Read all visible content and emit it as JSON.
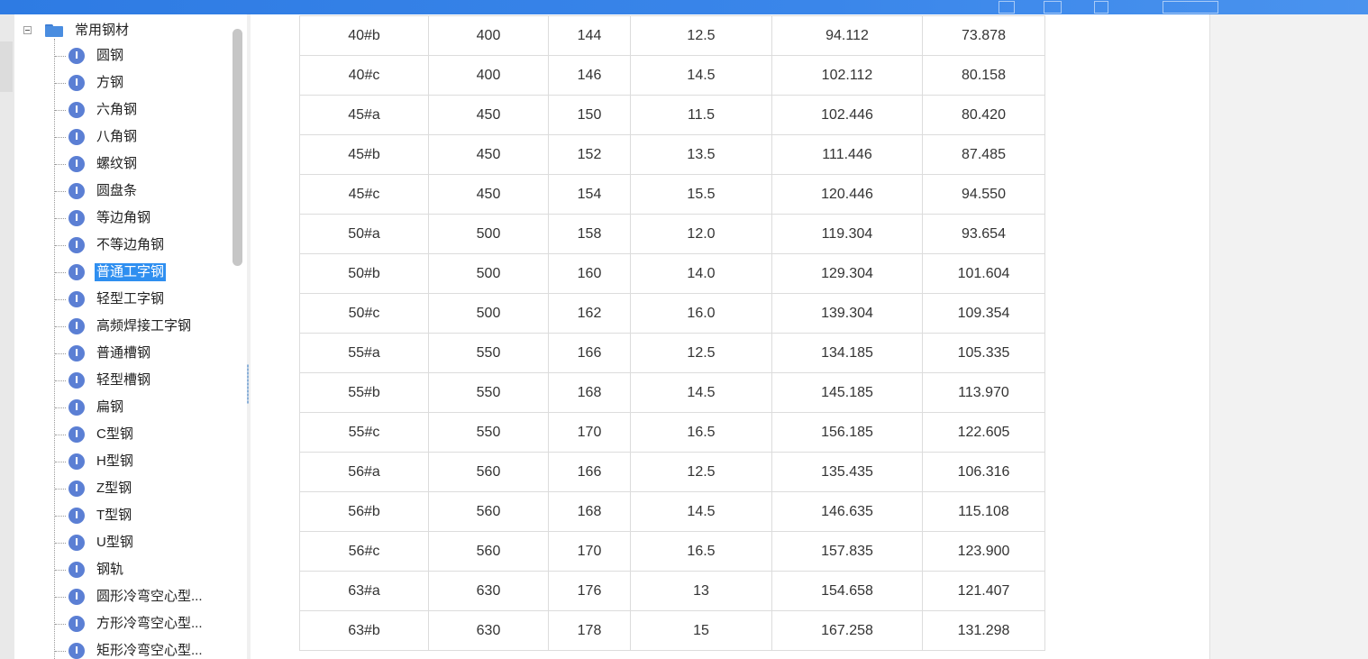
{
  "tree": {
    "root_label": "常用钢材",
    "item_icon_glyph": "I",
    "selected_index": 8,
    "items": [
      {
        "label": "圆钢"
      },
      {
        "label": "方钢"
      },
      {
        "label": "六角钢"
      },
      {
        "label": "八角钢"
      },
      {
        "label": "螺纹钢"
      },
      {
        "label": "圆盘条"
      },
      {
        "label": "等边角钢"
      },
      {
        "label": "不等边角钢"
      },
      {
        "label": "普通工字钢"
      },
      {
        "label": "轻型工字钢"
      },
      {
        "label": "高频焊接工字钢"
      },
      {
        "label": "普通槽钢"
      },
      {
        "label": "轻型槽钢"
      },
      {
        "label": "扁钢"
      },
      {
        "label": "C型钢"
      },
      {
        "label": "H型钢"
      },
      {
        "label": "Z型钢"
      },
      {
        "label": "T型钢"
      },
      {
        "label": "U型钢"
      },
      {
        "label": "钢轨"
      },
      {
        "label": "圆形冷弯空心型..."
      },
      {
        "label": "方形冷弯空心型..."
      },
      {
        "label": "矩形冷弯空心型..."
      }
    ]
  },
  "table": {
    "rows": [
      [
        "40#b",
        "400",
        "144",
        "12.5",
        "94.112",
        "73.878"
      ],
      [
        "40#c",
        "400",
        "146",
        "14.5",
        "102.112",
        "80.158"
      ],
      [
        "45#a",
        "450",
        "150",
        "11.5",
        "102.446",
        "80.420"
      ],
      [
        "45#b",
        "450",
        "152",
        "13.5",
        "111.446",
        "87.485"
      ],
      [
        "45#c",
        "450",
        "154",
        "15.5",
        "120.446",
        "94.550"
      ],
      [
        "50#a",
        "500",
        "158",
        "12.0",
        "119.304",
        "93.654"
      ],
      [
        "50#b",
        "500",
        "160",
        "14.0",
        "129.304",
        "101.604"
      ],
      [
        "50#c",
        "500",
        "162",
        "16.0",
        "139.304",
        "109.354"
      ],
      [
        "55#a",
        "550",
        "166",
        "12.5",
        "134.185",
        "105.335"
      ],
      [
        "55#b",
        "550",
        "168",
        "14.5",
        "145.185",
        "113.970"
      ],
      [
        "55#c",
        "550",
        "170",
        "16.5",
        "156.185",
        "122.605"
      ],
      [
        "56#a",
        "560",
        "166",
        "12.5",
        "135.435",
        "106.316"
      ],
      [
        "56#b",
        "560",
        "168",
        "14.5",
        "146.635",
        "115.108"
      ],
      [
        "56#c",
        "560",
        "170",
        "16.5",
        "157.835",
        "123.900"
      ],
      [
        "63#a",
        "630",
        "176",
        "13",
        "154.658",
        "121.407"
      ],
      [
        "63#b",
        "630",
        "178",
        "15",
        "167.258",
        "131.298"
      ]
    ]
  },
  "colors": {
    "titlebar": "#3a86ea",
    "selection": "#2f8ff0",
    "item_icon": "#5b7fd4",
    "folder": "#4a8de0",
    "grid_border": "#dcdcdc"
  }
}
